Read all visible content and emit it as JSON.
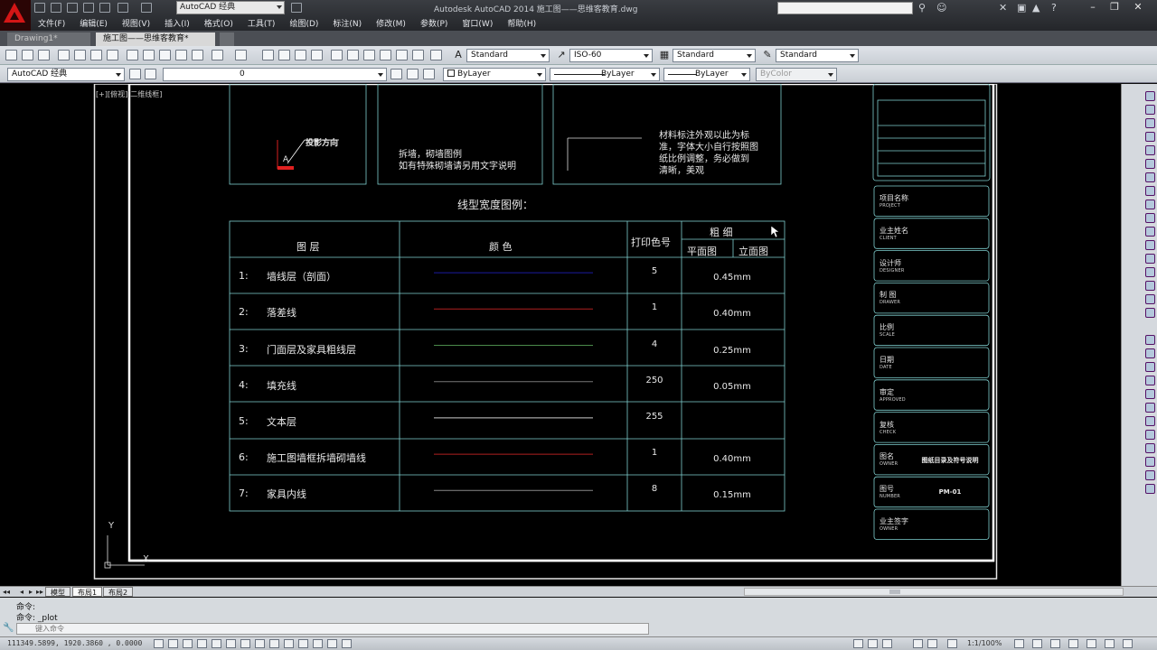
{
  "titlebar": {
    "workspace": "AutoCAD 经典",
    "title": "Autodesk AutoCAD 2014    施工图——思维客教育.dwg"
  },
  "menu": [
    "文件(F)",
    "编辑(E)",
    "视图(V)",
    "插入(I)",
    "格式(O)",
    "工具(T)",
    "绘图(D)",
    "标注(N)",
    "修改(M)",
    "参数(P)",
    "窗口(W)",
    "帮助(H)"
  ],
  "doc_tabs": [
    "Drawing1*",
    "施工图——思维客教育*"
  ],
  "toolbar": {
    "text_style": "Standard",
    "dim_style": "ISO-60",
    "table_style": "Standard",
    "multileader_style": "Standard",
    "workspace": "AutoCAD 经典",
    "layer": "0",
    "color": "ByLayer",
    "linetype": "ByLayer",
    "lineweight": "ByLayer",
    "plot_style": "ByColor"
  },
  "viewport_label": "[+][俯视][二维线框]",
  "legend_boxes": {
    "projection_label": "投影方向",
    "projection_letter": "A",
    "demolish_text_1": "拆墙，砌墙图例",
    "demolish_text_2": "如有特殊砌墙请另用文字说明",
    "material_text": [
      "材料标注外观以此为标",
      "准，字体大小自行按照图",
      "纸比例调整，务必做到",
      "清晰，美观"
    ]
  },
  "lineweight_table": {
    "title": "线型宽度图例：",
    "headers": {
      "layer": "图   层",
      "color": "颜   色",
      "print_color": "打印色号",
      "weight": "粗    细",
      "plan": "平面图",
      "elevation": "立面图"
    },
    "rows": [
      {
        "index": "1:",
        "name": "墙线层（剖面）",
        "color": "#1a1aa0",
        "print": "5",
        "plan_weight": "0.45mm"
      },
      {
        "index": "2:",
        "name": "落差线",
        "color": "#b02020",
        "print": "1",
        "plan_weight": "0.40mm"
      },
      {
        "index": "3:",
        "name": "门面层及家具粗线层",
        "color": "#4a8a4a",
        "print": "4",
        "plan_weight": "0.25mm"
      },
      {
        "index": "4:",
        "name": "填充线",
        "color": "#777777",
        "print": "250",
        "plan_weight": "0.05mm"
      },
      {
        "index": "5:",
        "name": "文本层",
        "color": "#cccccc",
        "print": "255",
        "plan_weight": ""
      },
      {
        "index": "6:",
        "name": "施工图墙框拆墙砌墙线",
        "color": "#b02020",
        "print": "1",
        "plan_weight": "0.40mm"
      },
      {
        "index": "7:",
        "name": "家具内线",
        "color": "#888888",
        "print": "8",
        "plan_weight": "0.15mm"
      }
    ]
  },
  "title_block": [
    {
      "cn": "项目名称",
      "en": "PROJECT",
      "value": ""
    },
    {
      "cn": "业主姓名",
      "en": "CLIENT",
      "value": ""
    },
    {
      "cn": "设计师",
      "en": "DESIGNER",
      "value": ""
    },
    {
      "cn": "制  图",
      "en": "DRAWER",
      "value": ""
    },
    {
      "cn": "比例",
      "en": "SCALE",
      "value": ""
    },
    {
      "cn": "日期",
      "en": "DATE",
      "value": ""
    },
    {
      "cn": "审定",
      "en": "APPROVED",
      "value": ""
    },
    {
      "cn": "复核",
      "en": "CHECK",
      "value": ""
    },
    {
      "cn": "图名",
      "en": "OWNER",
      "value": "图纸目录及符号说明"
    },
    {
      "cn": "图号",
      "en": "NUMBER",
      "value": "PM-01"
    },
    {
      "cn": "业主签字",
      "en": "OWNER",
      "value": ""
    }
  ],
  "layout_tabs": [
    "模型",
    "布局1",
    "布局2"
  ],
  "command": {
    "line1": "命令:",
    "line2": "命令: _plot",
    "placeholder": "键入命令"
  },
  "status": {
    "coords": "111349.5899, 1920.3860 , 0.0000",
    "scale": "1:1/100%"
  },
  "ucs": {
    "x": "X",
    "y": "Y"
  }
}
